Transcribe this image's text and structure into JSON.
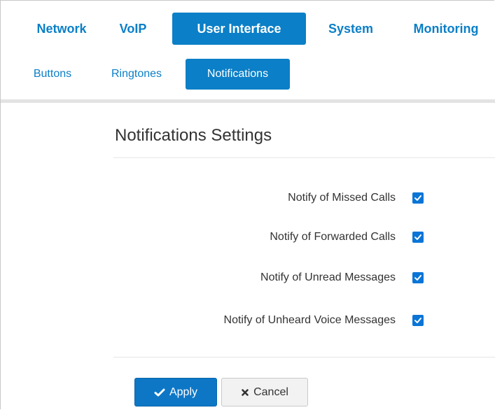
{
  "main_tabs": [
    {
      "label": "Network",
      "active": false
    },
    {
      "label": "VoIP",
      "active": false
    },
    {
      "label": "User Interface",
      "active": true
    },
    {
      "label": "System",
      "active": false
    },
    {
      "label": "Monitoring",
      "active": false
    }
  ],
  "sub_tabs": [
    {
      "label": "Buttons",
      "active": false
    },
    {
      "label": "Ringtones",
      "active": false
    },
    {
      "label": "Notifications",
      "active": true
    }
  ],
  "section": {
    "title": "Notifications Settings",
    "settings": [
      {
        "label": "Notify of Missed Calls",
        "checked": true
      },
      {
        "label": "Notify of Forwarded Calls",
        "checked": true
      },
      {
        "label": "Notify of Unread Messages",
        "checked": true
      },
      {
        "label": "Notify of Unheard Voice Messages",
        "checked": true
      }
    ]
  },
  "actions": {
    "apply_label": "Apply",
    "apply_icon": "check-icon",
    "cancel_label": "Cancel",
    "cancel_icon": "close-icon"
  },
  "colors": {
    "accent": "#0b7fc7",
    "checkbox": "#0a75d6"
  }
}
